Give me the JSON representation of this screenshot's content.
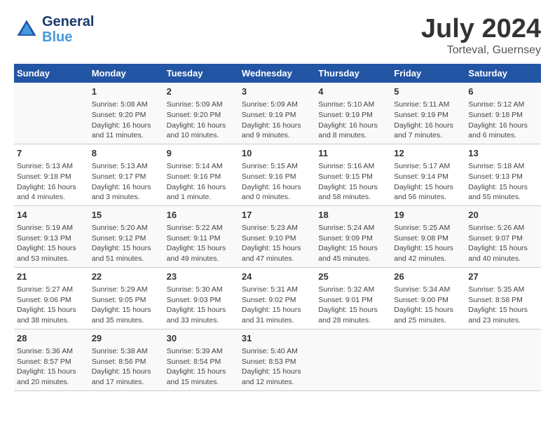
{
  "header": {
    "logo_general": "General",
    "logo_blue": "Blue",
    "month_title": "July 2024",
    "location": "Torteval, Guernsey"
  },
  "weekdays": [
    "Sunday",
    "Monday",
    "Tuesday",
    "Wednesday",
    "Thursday",
    "Friday",
    "Saturday"
  ],
  "weeks": [
    [
      {
        "day": "",
        "info": ""
      },
      {
        "day": "1",
        "info": "Sunrise: 5:08 AM\nSunset: 9:20 PM\nDaylight: 16 hours\nand 11 minutes."
      },
      {
        "day": "2",
        "info": "Sunrise: 5:09 AM\nSunset: 9:20 PM\nDaylight: 16 hours\nand 10 minutes."
      },
      {
        "day": "3",
        "info": "Sunrise: 5:09 AM\nSunset: 9:19 PM\nDaylight: 16 hours\nand 9 minutes."
      },
      {
        "day": "4",
        "info": "Sunrise: 5:10 AM\nSunset: 9:19 PM\nDaylight: 16 hours\nand 8 minutes."
      },
      {
        "day": "5",
        "info": "Sunrise: 5:11 AM\nSunset: 9:19 PM\nDaylight: 16 hours\nand 7 minutes."
      },
      {
        "day": "6",
        "info": "Sunrise: 5:12 AM\nSunset: 9:18 PM\nDaylight: 16 hours\nand 6 minutes."
      }
    ],
    [
      {
        "day": "7",
        "info": "Sunrise: 5:13 AM\nSunset: 9:18 PM\nDaylight: 16 hours\nand 4 minutes."
      },
      {
        "day": "8",
        "info": "Sunrise: 5:13 AM\nSunset: 9:17 PM\nDaylight: 16 hours\nand 3 minutes."
      },
      {
        "day": "9",
        "info": "Sunrise: 5:14 AM\nSunset: 9:16 PM\nDaylight: 16 hours\nand 1 minute."
      },
      {
        "day": "10",
        "info": "Sunrise: 5:15 AM\nSunset: 9:16 PM\nDaylight: 16 hours\nand 0 minutes."
      },
      {
        "day": "11",
        "info": "Sunrise: 5:16 AM\nSunset: 9:15 PM\nDaylight: 15 hours\nand 58 minutes."
      },
      {
        "day": "12",
        "info": "Sunrise: 5:17 AM\nSunset: 9:14 PM\nDaylight: 15 hours\nand 56 minutes."
      },
      {
        "day": "13",
        "info": "Sunrise: 5:18 AM\nSunset: 9:13 PM\nDaylight: 15 hours\nand 55 minutes."
      }
    ],
    [
      {
        "day": "14",
        "info": "Sunrise: 5:19 AM\nSunset: 9:13 PM\nDaylight: 15 hours\nand 53 minutes."
      },
      {
        "day": "15",
        "info": "Sunrise: 5:20 AM\nSunset: 9:12 PM\nDaylight: 15 hours\nand 51 minutes."
      },
      {
        "day": "16",
        "info": "Sunrise: 5:22 AM\nSunset: 9:11 PM\nDaylight: 15 hours\nand 49 minutes."
      },
      {
        "day": "17",
        "info": "Sunrise: 5:23 AM\nSunset: 9:10 PM\nDaylight: 15 hours\nand 47 minutes."
      },
      {
        "day": "18",
        "info": "Sunrise: 5:24 AM\nSunset: 9:09 PM\nDaylight: 15 hours\nand 45 minutes."
      },
      {
        "day": "19",
        "info": "Sunrise: 5:25 AM\nSunset: 9:08 PM\nDaylight: 15 hours\nand 42 minutes."
      },
      {
        "day": "20",
        "info": "Sunrise: 5:26 AM\nSunset: 9:07 PM\nDaylight: 15 hours\nand 40 minutes."
      }
    ],
    [
      {
        "day": "21",
        "info": "Sunrise: 5:27 AM\nSunset: 9:06 PM\nDaylight: 15 hours\nand 38 minutes."
      },
      {
        "day": "22",
        "info": "Sunrise: 5:29 AM\nSunset: 9:05 PM\nDaylight: 15 hours\nand 35 minutes."
      },
      {
        "day": "23",
        "info": "Sunrise: 5:30 AM\nSunset: 9:03 PM\nDaylight: 15 hours\nand 33 minutes."
      },
      {
        "day": "24",
        "info": "Sunrise: 5:31 AM\nSunset: 9:02 PM\nDaylight: 15 hours\nand 31 minutes."
      },
      {
        "day": "25",
        "info": "Sunrise: 5:32 AM\nSunset: 9:01 PM\nDaylight: 15 hours\nand 28 minutes."
      },
      {
        "day": "26",
        "info": "Sunrise: 5:34 AM\nSunset: 9:00 PM\nDaylight: 15 hours\nand 25 minutes."
      },
      {
        "day": "27",
        "info": "Sunrise: 5:35 AM\nSunset: 8:58 PM\nDaylight: 15 hours\nand 23 minutes."
      }
    ],
    [
      {
        "day": "28",
        "info": "Sunrise: 5:36 AM\nSunset: 8:57 PM\nDaylight: 15 hours\nand 20 minutes."
      },
      {
        "day": "29",
        "info": "Sunrise: 5:38 AM\nSunset: 8:56 PM\nDaylight: 15 hours\nand 17 minutes."
      },
      {
        "day": "30",
        "info": "Sunrise: 5:39 AM\nSunset: 8:54 PM\nDaylight: 15 hours\nand 15 minutes."
      },
      {
        "day": "31",
        "info": "Sunrise: 5:40 AM\nSunset: 8:53 PM\nDaylight: 15 hours\nand 12 minutes."
      },
      {
        "day": "",
        "info": ""
      },
      {
        "day": "",
        "info": ""
      },
      {
        "day": "",
        "info": ""
      }
    ]
  ]
}
